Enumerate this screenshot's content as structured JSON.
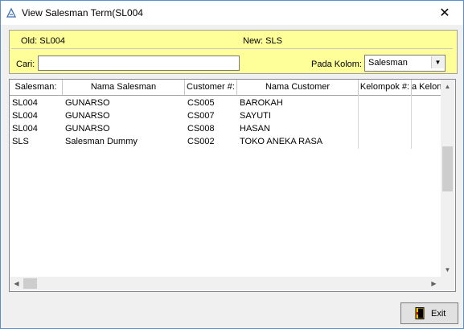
{
  "window": {
    "title": "View Salesman Term(SL004"
  },
  "filter": {
    "old_label": "Old: SL004",
    "new_label": "New: SLS",
    "cari_label": "Cari:",
    "cari_value": "",
    "pada_kolom_label": "Pada Kolom:",
    "pada_kolom_value": "Salesman"
  },
  "table": {
    "columns": [
      "Salesman:",
      "Nama Salesman",
      "Customer #:",
      "Nama Customer",
      "Kelompok #:",
      "a Kelon"
    ],
    "rows": [
      [
        "SL004",
        "GUNARSO",
        "CS005",
        "BAROKAH",
        "",
        ""
      ],
      [
        "SL004",
        "GUNARSO",
        "CS007",
        "SAYUTI",
        "",
        ""
      ],
      [
        "SL004",
        "GUNARSO",
        "CS008",
        "HASAN",
        "",
        ""
      ],
      [
        "SLS",
        "Salesman Dummy",
        "CS002",
        "TOKO ANEKA RASA",
        "",
        ""
      ]
    ]
  },
  "buttons": {
    "exit_label": "Exit"
  },
  "colors": {
    "filter_panel": "#ffff99",
    "window_border": "#5a8fcf"
  }
}
